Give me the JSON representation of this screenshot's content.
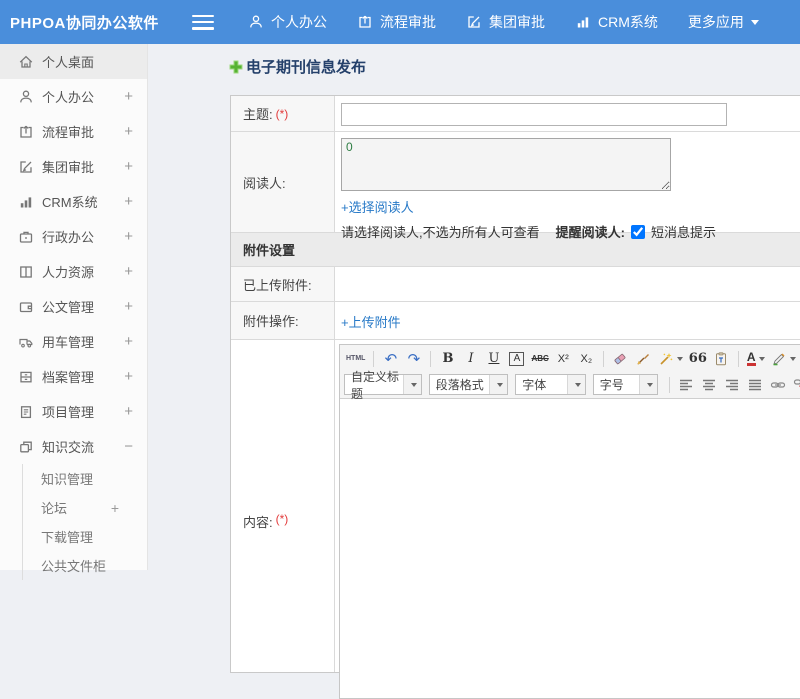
{
  "header": {
    "logo": "PHPOA协同办公软件",
    "nav": [
      {
        "label": "个人办公",
        "icon": "user-icon"
      },
      {
        "label": "流程审批",
        "icon": "flow-icon"
      },
      {
        "label": "集团审批",
        "icon": "edit-icon"
      },
      {
        "label": "CRM系统",
        "icon": "chart-icon"
      },
      {
        "label": "更多应用",
        "icon": "caret-down-icon"
      }
    ]
  },
  "sidebar": {
    "items": [
      {
        "label": "个人桌面",
        "toggle": "",
        "icon": "home-icon",
        "active": true
      },
      {
        "label": "个人办公",
        "toggle": "+",
        "icon": "user-icon"
      },
      {
        "label": "流程审批",
        "toggle": "+",
        "icon": "flow-icon"
      },
      {
        "label": "集团审批",
        "toggle": "+",
        "icon": "edit-icon"
      },
      {
        "label": "CRM系统",
        "toggle": "+",
        "icon": "chart-icon"
      },
      {
        "label": "行政办公",
        "toggle": "+",
        "icon": "briefcase-icon"
      },
      {
        "label": "人力资源",
        "toggle": "+",
        "icon": "book-icon"
      },
      {
        "label": "公文管理",
        "toggle": "+",
        "icon": "wallet-icon"
      },
      {
        "label": "用车管理",
        "toggle": "+",
        "icon": "truck-icon"
      },
      {
        "label": "档案管理",
        "toggle": "+",
        "icon": "archive-icon"
      },
      {
        "label": "项目管理",
        "toggle": "+",
        "icon": "document-icon"
      },
      {
        "label": "知识交流",
        "toggle": "−",
        "icon": "layers-icon",
        "expanded": true
      }
    ],
    "subitems": [
      {
        "label": "知识管理",
        "toggle": ""
      },
      {
        "label": "论坛",
        "toggle": "+"
      },
      {
        "label": "下载管理",
        "toggle": ""
      },
      {
        "label": "公共文件柜",
        "toggle": ""
      }
    ]
  },
  "main": {
    "page_title": "电子期刊信息发布",
    "form": {
      "subject_label": "主题:",
      "required_mark": "(*)",
      "subject_value": "",
      "readers_label": "阅读人:",
      "readers_value": "0",
      "select_readers_link": "+选择阅读人",
      "readers_hint": "请选择阅读人,不选为所有人可查看",
      "remind_label": "提醒阅读人:",
      "sms_checked": true,
      "sms_label": "短消息提示",
      "attachments_section_title": "附件设置",
      "uploaded_label": "已上传附件:",
      "operations_label": "附件操作:",
      "upload_link": "+上传附件",
      "content_label": "内容:"
    },
    "editor": {
      "dropdowns": [
        "自定义标题",
        "段落格式",
        "字体",
        "字号"
      ],
      "glyphs": {
        "html": "HTML",
        "undo": "↶",
        "redo": "↷",
        "bold": "B",
        "italic": "I",
        "underline": "U",
        "font_box": "A",
        "strike": "ABC",
        "sup": "X²",
        "sub": "X₂",
        "quote": "66",
        "font_color": "A"
      }
    }
  },
  "colors": {
    "header_blue": "#4a8edb",
    "link_blue": "#2779c7",
    "title_navy": "#25416b",
    "required_red": "#e23b3b",
    "reader_green": "#2e7d43",
    "plus_green": "#57b233"
  }
}
